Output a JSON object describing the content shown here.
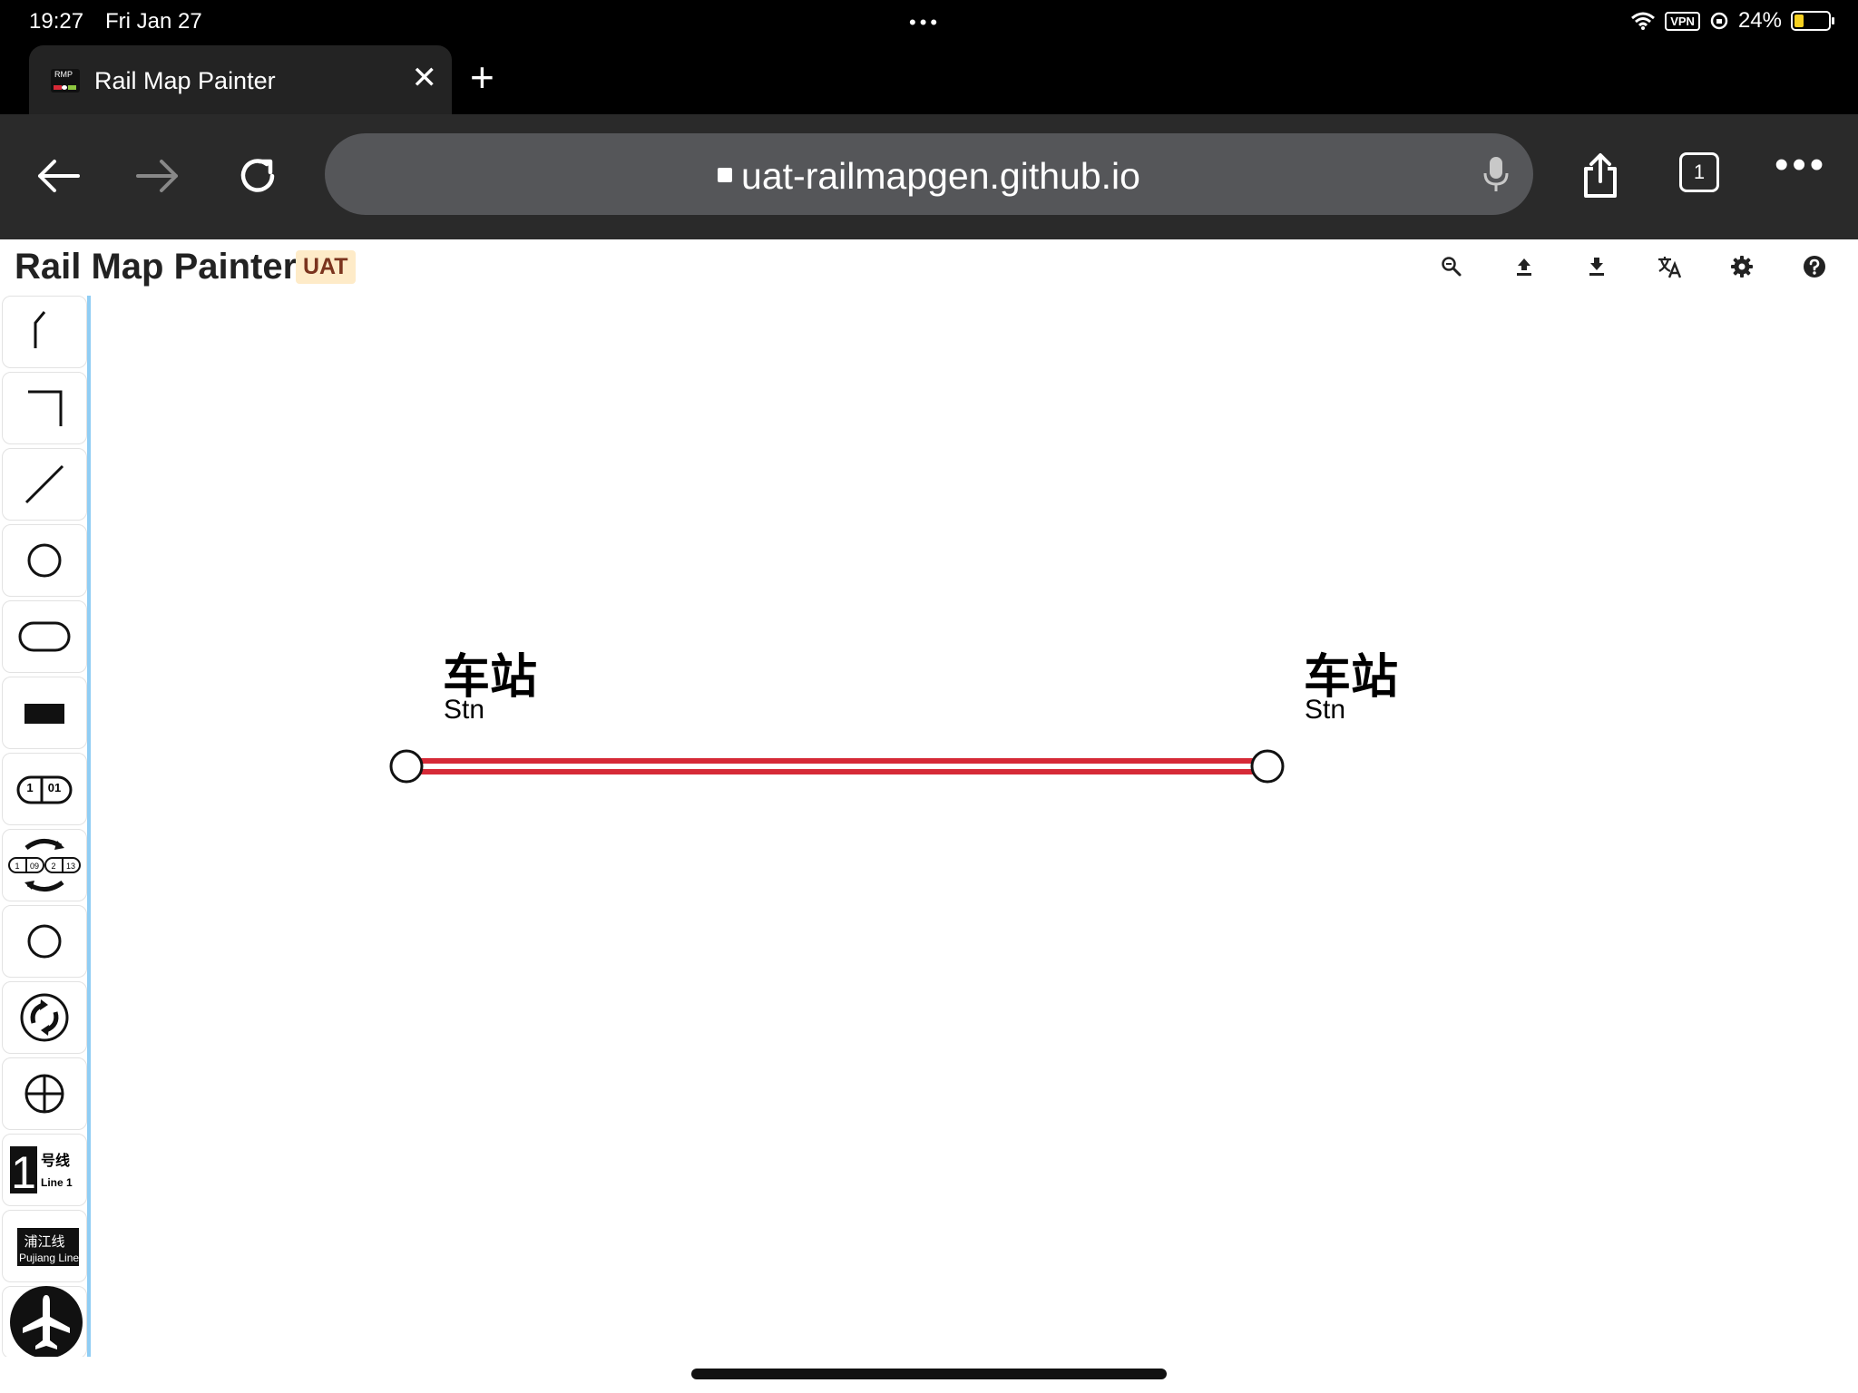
{
  "status_bar": {
    "time": "19:27",
    "date": "Fri Jan 27",
    "vpn": "VPN",
    "battery": "24%"
  },
  "browser": {
    "tab_title": "Rail Map Painter",
    "favicon_text": "RMP",
    "url": "uat-railmapgen.github.io",
    "tab_count": "1"
  },
  "app": {
    "title": "Rail Map Painter",
    "badge": "UAT",
    "header_icons": [
      "zoom-out-icon",
      "upload-icon",
      "download-icon",
      "translate-icon",
      "settings-icon",
      "help-icon"
    ]
  },
  "tools": {
    "line_label_number": "1",
    "line_label_zh": "号线",
    "line_label_en": "Line 1",
    "pujiang_zh": "浦江线",
    "pujiang_en": "Pujiang Line",
    "station_num_a": "1",
    "station_num_b": "01",
    "int_num_a": "1",
    "int_num_b": "09",
    "int_num_c": "2",
    "int_num_d": "13"
  },
  "canvas": {
    "stations": [
      {
        "name_zh": "车站",
        "name_en": "Stn"
      },
      {
        "name_zh": "车站",
        "name_en": "Stn"
      }
    ],
    "line_color": "#d62a37"
  }
}
